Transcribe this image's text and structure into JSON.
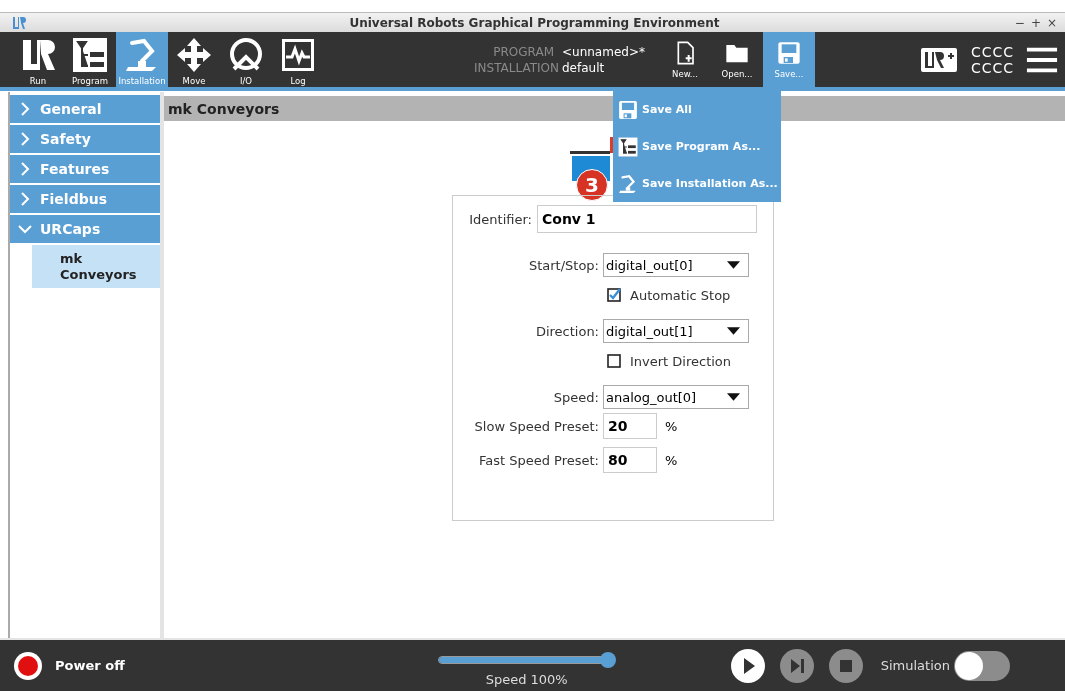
{
  "window": {
    "title": "Universal Robots Graphical Programming Environment",
    "controls": [
      "−",
      "+",
      "×"
    ]
  },
  "nav_tabs": [
    {
      "label": "Run",
      "selected": false
    },
    {
      "label": "Program",
      "selected": false
    },
    {
      "label": "Installation",
      "selected": true
    },
    {
      "label": "Move",
      "selected": false
    },
    {
      "label": "I/O",
      "selected": false
    },
    {
      "label": "Log",
      "selected": false
    }
  ],
  "file_info": [
    {
      "label": "PROGRAM",
      "value": "<unnamed>*"
    },
    {
      "label": "INSTALLATION",
      "value": "default"
    }
  ],
  "file_buttons": [
    {
      "label": "New...",
      "selected": false
    },
    {
      "label": "Open...",
      "selected": false
    },
    {
      "label": "Save...",
      "selected": true
    }
  ],
  "user": {
    "line1": "CCCC",
    "line2": "CCCC"
  },
  "save_menu": [
    {
      "label": "Save All"
    },
    {
      "label": "Save Program As..."
    },
    {
      "label": "Save Installation As..."
    }
  ],
  "sidebar": [
    {
      "label": "General",
      "expanded": false
    },
    {
      "label": "Safety",
      "expanded": false
    },
    {
      "label": "Features",
      "expanded": false
    },
    {
      "label": "Fieldbus",
      "expanded": false
    },
    {
      "label": "URCaps",
      "expanded": true,
      "children": [
        {
          "label": "mk\nConveyors",
          "selected": true
        }
      ]
    }
  ],
  "content": {
    "header": "mk Conveyors",
    "callout": "3",
    "identifier": {
      "label": "Identifier:",
      "value": "Conv 1"
    },
    "rows": [
      {
        "kind": "select",
        "label": "Start/Stop:",
        "value": "digital_out[0]"
      },
      {
        "kind": "checkbox",
        "label": "Automatic Stop",
        "checked": true
      },
      {
        "kind": "select",
        "label": "Direction:",
        "value": "digital_out[1]"
      },
      {
        "kind": "checkbox",
        "label": "Invert Direction",
        "checked": false
      },
      {
        "kind": "select",
        "label": "Speed:",
        "value": "analog_out[0]"
      },
      {
        "kind": "number",
        "label": "Slow Speed Preset:",
        "value": "20",
        "unit": "%"
      },
      {
        "kind": "number",
        "label": "Fast Speed Preset:",
        "value": "80",
        "unit": "%"
      }
    ]
  },
  "footer": {
    "power": "Power off",
    "speed": {
      "level": 1.0,
      "label": "Speed 100%"
    },
    "simulation": {
      "label": "Simulation",
      "on": false
    }
  }
}
